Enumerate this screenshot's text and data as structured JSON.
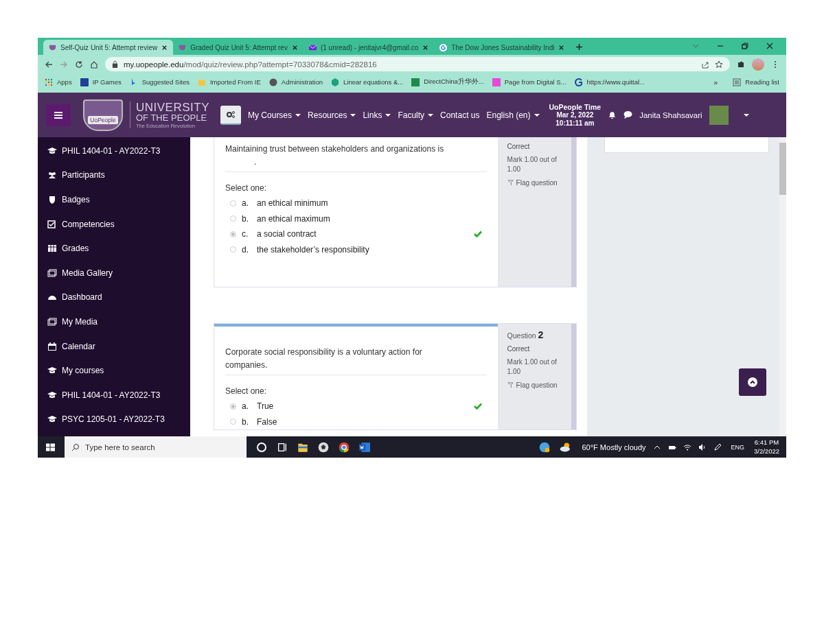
{
  "browser": {
    "tabs": [
      {
        "title": "Self-Quiz Unit 5: Attempt review",
        "selected": true
      },
      {
        "title": "Graded Quiz Unit 5: Attempt rev",
        "selected": false
      },
      {
        "title": "(1 unread) - jenitajvr4@gmail.co",
        "selected": false
      },
      {
        "title": "The Dow Jones Sustainability Indi",
        "selected": false
      }
    ],
    "url_domain": "my.uopeople.edu",
    "url_path": "/mod/quiz/review.php?attempt=7033078&cmid=282816",
    "bookmarks": [
      "Apps",
      "IP Games",
      "Suggested Sites",
      "Imported From IE",
      "Administration",
      "Linear equations &...",
      "DirectChina升华外...",
      "Page from Digital S...",
      "https://www.quittal..."
    ],
    "more_bookmarks": "»",
    "reading_list": "Reading list"
  },
  "navbar": {
    "logo_badge": "UoPeople",
    "logo_line1": "UNIVERSITY",
    "logo_line2": "OF THE PEOPLE",
    "logo_tagline": "The Education Revolution",
    "menu": [
      {
        "label": "My Courses",
        "dropdown": true
      },
      {
        "label": "Resources",
        "dropdown": true
      },
      {
        "label": "Links",
        "dropdown": true
      },
      {
        "label": "Faculty",
        "dropdown": true
      },
      {
        "label": "Contact us",
        "dropdown": false
      },
      {
        "label": "English (en)",
        "dropdown": true
      }
    ],
    "time_label": "UoPeople Time",
    "date": "Mar 2, 2022",
    "time": "10:11:11 am",
    "user": "Janita Shahsavari"
  },
  "sidebar": {
    "items": [
      "PHIL 1404-01 - AY2022-T3",
      "Participants",
      "Badges",
      "Competencies",
      "Grades",
      "Media Gallery",
      "Dashboard",
      "My Media",
      "Calendar",
      "My courses",
      "PHIL 1404-01 - AY2022-T3",
      "PSYC 1205-01 - AY2022-T3"
    ]
  },
  "questions": [
    {
      "state": "Correct",
      "mark": "Mark 1.00 out of 1.00",
      "flag": "Flag question",
      "text": "Maintaining trust between stakeholders and organizations is",
      "blank_end": ".",
      "prompt": "Select one:",
      "current": false,
      "options": [
        {
          "letter": "a.",
          "text": "an ethical minimum",
          "selected": false,
          "correct": false
        },
        {
          "letter": "b.",
          "text": "an ethical maximum",
          "selected": false,
          "correct": false
        },
        {
          "letter": "c.",
          "text": "a social contract",
          "selected": true,
          "correct": true
        },
        {
          "letter": "d.",
          "text": "the stakeholder’s responsibility",
          "selected": false,
          "correct": false
        }
      ]
    },
    {
      "number": "Question **2**",
      "state": "Correct",
      "mark": "Mark 1.00 out of 1.00",
      "flag": "Flag question",
      "text": "Corporate social responsibility is a voluntary action for companies.",
      "prompt": "Select one:",
      "current": true,
      "options": [
        {
          "letter": "a.",
          "text": "True",
          "selected": true,
          "correct": true
        },
        {
          "letter": "b.",
          "text": "False",
          "selected": false,
          "correct": false
        }
      ]
    }
  ],
  "taskbar": {
    "search_placeholder": "Type here to search",
    "weather": "60°F  Mostly cloudy",
    "language": "ENG",
    "time": "6:41 PM",
    "date": "3/2/2022"
  }
}
